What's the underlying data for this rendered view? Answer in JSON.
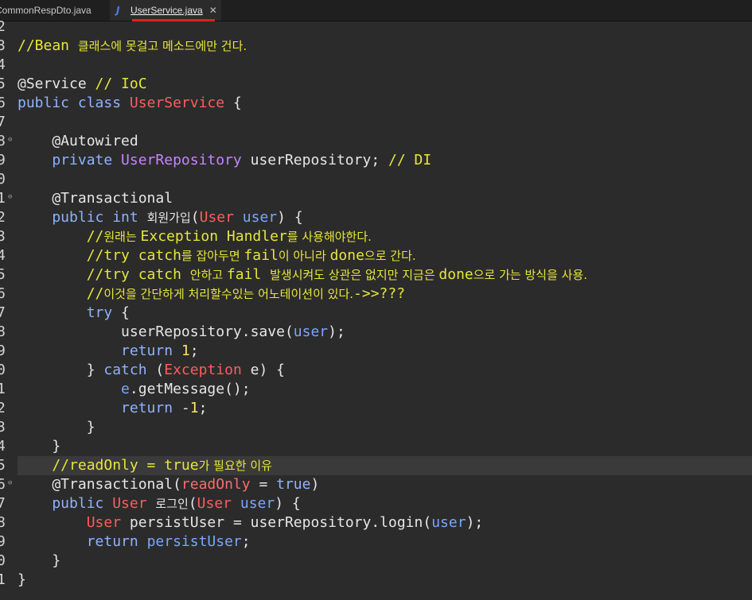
{
  "tabs": [
    {
      "label": "CommonRespDto.java"
    },
    {
      "label": "UserService.java",
      "icon": "J"
    }
  ],
  "colors": {
    "background": "#2b2b2b",
    "comment": "#e6e63c",
    "class": "#ff5c5c",
    "keyword": "#8fb3ff",
    "type": "#c584ff",
    "accent_underline": "#e02020"
  },
  "lines": [
    {
      "n": "2",
      "fold": "",
      "tokens": []
    },
    {
      "n": "3",
      "fold": "",
      "tokens": [
        {
          "t": "//Bean ",
          "c": "c-comment"
        },
        {
          "t": "클래스에 못걸고 메소드에만 건다.",
          "c": "c-comment ko"
        }
      ]
    },
    {
      "n": "4",
      "fold": "",
      "tokens": []
    },
    {
      "n": "5",
      "fold": "",
      "tokens": [
        {
          "t": "@Service ",
          "c": "c-anno"
        },
        {
          "t": "// IoC",
          "c": "c-comment"
        }
      ]
    },
    {
      "n": "6",
      "fold": "",
      "tokens": [
        {
          "t": "public class ",
          "c": "c-keyword"
        },
        {
          "t": "UserService",
          "c": "c-class"
        },
        {
          "t": " {",
          "c": "c-plain"
        }
      ]
    },
    {
      "n": "7",
      "fold": "",
      "tokens": []
    },
    {
      "n": "8",
      "fold": "⊖",
      "tokens": [
        {
          "t": "    @Autowired",
          "c": "c-anno"
        }
      ]
    },
    {
      "n": "9",
      "fold": "",
      "tokens": [
        {
          "t": "    private ",
          "c": "c-keyword"
        },
        {
          "t": "UserRepository",
          "c": "c-type"
        },
        {
          "t": " userRepository; ",
          "c": "c-plain"
        },
        {
          "t": "// DI",
          "c": "c-comment"
        }
      ]
    },
    {
      "n": "0",
      "fold": "",
      "tokens": []
    },
    {
      "n": "1",
      "fold": "⊖",
      "tokens": [
        {
          "t": "    @Transactional",
          "c": "c-anno"
        }
      ]
    },
    {
      "n": "2",
      "fold": "",
      "tokens": [
        {
          "t": "    public int ",
          "c": "c-keyword"
        },
        {
          "t": "회원가입",
          "c": "c-plain ko"
        },
        {
          "t": "(",
          "c": "c-plain"
        },
        {
          "t": "User",
          "c": "c-class"
        },
        {
          "t": " user",
          "c": "c-var"
        },
        {
          "t": ") {",
          "c": "c-plain"
        }
      ]
    },
    {
      "n": "3",
      "fold": "",
      "tokens": [
        {
          "t": "        //",
          "c": "c-comment"
        },
        {
          "t": "원래는 ",
          "c": "c-comment ko"
        },
        {
          "t": "Exception Handler",
          "c": "c-comment"
        },
        {
          "t": "를 사용해야한다.",
          "c": "c-comment ko"
        }
      ]
    },
    {
      "n": "4",
      "fold": "",
      "tokens": [
        {
          "t": "        //try catch",
          "c": "c-comment"
        },
        {
          "t": "를 잡아두면 ",
          "c": "c-comment ko"
        },
        {
          "t": "fail",
          "c": "c-comment"
        },
        {
          "t": "이 아니라 ",
          "c": "c-comment ko"
        },
        {
          "t": "done",
          "c": "c-comment"
        },
        {
          "t": "으로 간다.",
          "c": "c-comment ko"
        }
      ]
    },
    {
      "n": "5",
      "fold": "",
      "tokens": [
        {
          "t": "        //try catch ",
          "c": "c-comment"
        },
        {
          "t": "안하고 ",
          "c": "c-comment ko"
        },
        {
          "t": "fail ",
          "c": "c-comment"
        },
        {
          "t": "발생시켜도 상관은 없지만 지금은 ",
          "c": "c-comment ko"
        },
        {
          "t": "done",
          "c": "c-comment"
        },
        {
          "t": "으로 가는 방식을 사용.",
          "c": "c-comment ko"
        }
      ]
    },
    {
      "n": "6",
      "fold": "",
      "tokens": [
        {
          "t": "        //",
          "c": "c-comment"
        },
        {
          "t": "이것을 간단하게 처리할수있는 어노테이션이 있다.",
          "c": "c-comment ko"
        },
        {
          "t": "->>???",
          "c": "c-comment"
        }
      ]
    },
    {
      "n": "7",
      "fold": "",
      "tokens": [
        {
          "t": "        try",
          "c": "c-keyword"
        },
        {
          "t": " {",
          "c": "c-plain"
        }
      ]
    },
    {
      "n": "8",
      "fold": "",
      "tokens": [
        {
          "t": "            userRepository.save(",
          "c": "c-plain"
        },
        {
          "t": "user",
          "c": "c-var"
        },
        {
          "t": ");",
          "c": "c-plain"
        }
      ]
    },
    {
      "n": "9",
      "fold": "",
      "tokens": [
        {
          "t": "            return ",
          "c": "c-keyword"
        },
        {
          "t": "1",
          "c": "c-num"
        },
        {
          "t": ";",
          "c": "c-plain"
        }
      ]
    },
    {
      "n": "0",
      "fold": "",
      "tokens": [
        {
          "t": "        } ",
          "c": "c-plain"
        },
        {
          "t": "catch",
          "c": "c-keyword"
        },
        {
          "t": " (",
          "c": "c-plain"
        },
        {
          "t": "Exception",
          "c": "c-class"
        },
        {
          "t": " e) {",
          "c": "c-plain"
        }
      ]
    },
    {
      "n": "1",
      "fold": "",
      "tokens": [
        {
          "t": "            ",
          "c": "c-plain"
        },
        {
          "t": "e",
          "c": "c-var"
        },
        {
          "t": ".getMessage();",
          "c": "c-plain"
        }
      ]
    },
    {
      "n": "2",
      "fold": "",
      "tokens": [
        {
          "t": "            return ",
          "c": "c-keyword"
        },
        {
          "t": "-",
          "c": "c-plain"
        },
        {
          "t": "1",
          "c": "c-num"
        },
        {
          "t": ";",
          "c": "c-plain"
        }
      ]
    },
    {
      "n": "3",
      "fold": "",
      "tokens": [
        {
          "t": "        }",
          "c": "c-plain"
        }
      ]
    },
    {
      "n": "4",
      "fold": "",
      "tokens": [
        {
          "t": "    }",
          "c": "c-plain"
        }
      ]
    },
    {
      "n": "5",
      "fold": "",
      "hl": true,
      "tokens": [
        {
          "t": "    //readOnly = true",
          "c": "c-comment"
        },
        {
          "t": "가 필요한 이유",
          "c": "c-comment ko"
        }
      ]
    },
    {
      "n": "6",
      "fold": "⊖",
      "tokens": [
        {
          "t": "    @Transactional(",
          "c": "c-anno"
        },
        {
          "t": "readOnly",
          "c": "c-param"
        },
        {
          "t": " = ",
          "c": "c-plain"
        },
        {
          "t": "true",
          "c": "c-bool"
        },
        {
          "t": ")",
          "c": "c-plain"
        }
      ]
    },
    {
      "n": "7",
      "fold": "",
      "tokens": [
        {
          "t": "    public ",
          "c": "c-keyword"
        },
        {
          "t": "User",
          "c": "c-class"
        },
        {
          "t": " ",
          "c": "c-plain"
        },
        {
          "t": "로그인",
          "c": "c-plain ko"
        },
        {
          "t": "(",
          "c": "c-plain"
        },
        {
          "t": "User",
          "c": "c-class"
        },
        {
          "t": " user",
          "c": "c-var"
        },
        {
          "t": ") {",
          "c": "c-plain"
        }
      ]
    },
    {
      "n": "8",
      "fold": "",
      "tokens": [
        {
          "t": "        ",
          "c": "c-plain"
        },
        {
          "t": "User",
          "c": "c-class"
        },
        {
          "t": " persistUser = userRepository.login(",
          "c": "c-plain"
        },
        {
          "t": "user",
          "c": "c-var"
        },
        {
          "t": ");",
          "c": "c-plain"
        }
      ]
    },
    {
      "n": "9",
      "fold": "",
      "tokens": [
        {
          "t": "        return ",
          "c": "c-keyword"
        },
        {
          "t": "persistUser",
          "c": "c-var"
        },
        {
          "t": ";",
          "c": "c-plain"
        }
      ]
    },
    {
      "n": "0",
      "fold": "",
      "tokens": [
        {
          "t": "    }",
          "c": "c-plain"
        }
      ]
    },
    {
      "n": "1",
      "fold": "",
      "tokens": [
        {
          "t": "}",
          "c": "c-plain"
        }
      ]
    }
  ]
}
